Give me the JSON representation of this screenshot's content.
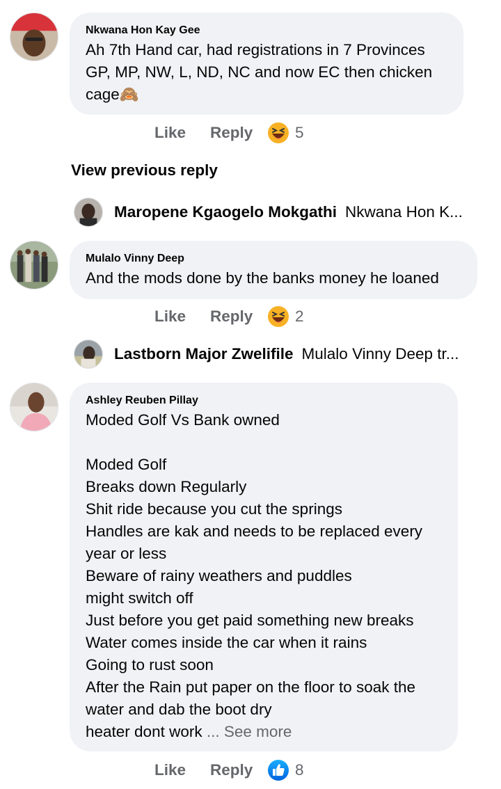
{
  "comments": [
    {
      "author": "Nkwana Hon Kay Gee",
      "text": "Ah 7th Hand car, had registrations in 7 Provinces GP, MP, NW, L, ND, NC and now EC then chicken cage🙈",
      "like_label": "Like",
      "reply_label": "Reply",
      "reaction": "haha-icon",
      "reaction_count": "5"
    },
    {
      "author": "Mulalo Vinny Deep",
      "text": "And the mods done by the banks money he loaned",
      "like_label": "Like",
      "reply_label": "Reply",
      "reaction": "haha-icon",
      "reaction_count": "2"
    },
    {
      "author": "Ashley Reuben Pillay",
      "text": "Moded Golf Vs Bank owned\n\nModed Golf\nBreaks down Regularly\nShit ride because you cut the springs\nHandles are kak and needs to be replaced every year or less\nBeware of rainy weathers and puddles\nmight switch off\nJust before you get paid something new breaks\nWater comes inside the car when it rains\nGoing to rust soon\nAfter the Rain put paper on the floor to soak the water and dab the boot dry\nheater dont work",
      "see_more": "... See more",
      "like_label": "Like",
      "reply_label": "Reply",
      "reaction": "like-icon",
      "reaction_count": "8"
    }
  ],
  "view_previous_reply": "View previous reply",
  "replies": [
    {
      "author": "Maropene Kgaogelo Mokgathi",
      "preview": "Nkwana Hon K..."
    },
    {
      "author": "Lastborn Major Zwelifile",
      "preview": "Mulalo Vinny Deep tr..."
    }
  ],
  "colors": {
    "bubble": "#f0f2f5",
    "muted": "#65676b",
    "like_blue": "#1877f2",
    "haha_yellow": "#f7b125"
  }
}
